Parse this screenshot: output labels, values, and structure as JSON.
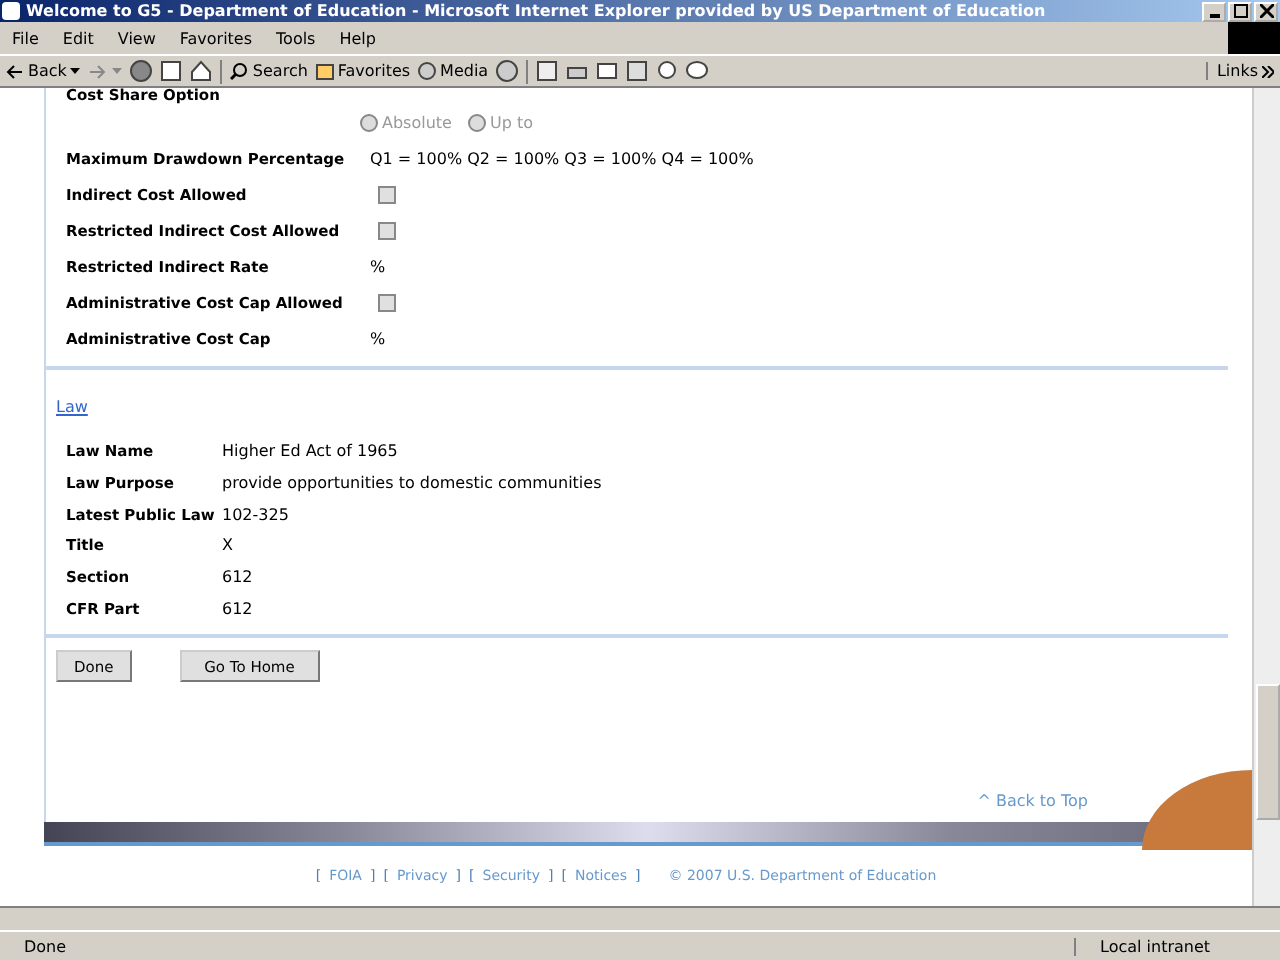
{
  "window": {
    "title": "Welcome to G5 - Department of Education - Microsoft Internet Explorer provided by US Department of Education"
  },
  "menu": [
    "File",
    "Edit",
    "View",
    "Favorites",
    "Tools",
    "Help"
  ],
  "toolbar": {
    "back": "Back",
    "search": "Search",
    "favorites": "Favorites",
    "media": "Media",
    "links": "Links"
  },
  "cost_share": {
    "label": "Cost Share Option",
    "options": [
      {
        "label": "Absolute",
        "selected": false,
        "disabled": true
      },
      {
        "label": "Up to",
        "selected": false,
        "disabled": true
      }
    ]
  },
  "fields": [
    {
      "kind": "text",
      "label": "Maximum Drawdown Percentage",
      "value": "Q1 = 100% Q2 = 100% Q3 = 100% Q4 = 100%"
    },
    {
      "kind": "checkbox",
      "label": "Indirect Cost Allowed",
      "checked": false
    },
    {
      "kind": "checkbox",
      "label": "Restricted Indirect Cost Allowed",
      "checked": false
    },
    {
      "kind": "text",
      "label": "Restricted Indirect Rate",
      "value": "%"
    },
    {
      "kind": "checkbox",
      "label": "Administrative Cost Cap Allowed",
      "checked": false
    },
    {
      "kind": "text",
      "label": "Administrative Cost Cap",
      "value": "%"
    }
  ],
  "law": {
    "heading": "Law",
    "rows": [
      {
        "label": "Law Name",
        "value": "Higher Ed Act of 1965"
      },
      {
        "label": "Law Purpose",
        "value": "provide opportunities to domestic communities"
      },
      {
        "label": "Latest Public Law",
        "value": "102-325"
      },
      {
        "label": "Title",
        "value": "X"
      },
      {
        "label": "Section",
        "value": "612"
      },
      {
        "label": "CFR Part",
        "value": "612"
      }
    ]
  },
  "buttons": [
    "Done",
    "Go To Home"
  ],
  "back_to_top": "^ Back to Top",
  "footer": {
    "items": [
      {
        "kind": "bracket",
        "text": "["
      },
      {
        "kind": "link",
        "text": "FOIA"
      },
      {
        "kind": "bracket",
        "text": "]"
      },
      {
        "kind": "bracket",
        "text": "["
      },
      {
        "kind": "link",
        "text": "Privacy"
      },
      {
        "kind": "bracket",
        "text": "]"
      },
      {
        "kind": "bracket",
        "text": "["
      },
      {
        "kind": "link",
        "text": "Security"
      },
      {
        "kind": "bracket",
        "text": "]"
      },
      {
        "kind": "bracket",
        "text": "["
      },
      {
        "kind": "link",
        "text": "Notices"
      },
      {
        "kind": "bracket",
        "text": "]"
      }
    ],
    "copyright": "© 2007 U.S. Department of Education"
  },
  "status_bar": {
    "text": "Done",
    "zone": "Local intranet"
  }
}
